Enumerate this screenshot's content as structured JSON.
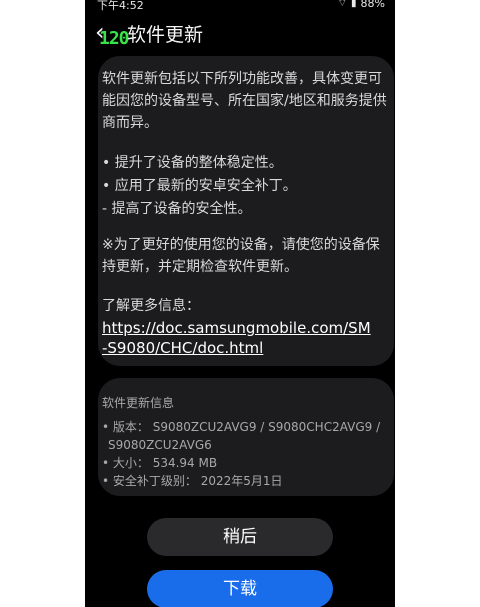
{
  "statusbar": {
    "time": "下午4:52",
    "battery": "88%"
  },
  "header": {
    "fps": "120",
    "title": "软件更新"
  },
  "intro": "软件更新包括以下所列功能改善，具体变更可能因您的设备型号、所在国家/地区和服务提供商而异。",
  "bullets": [
    "• 提升了设备的整体稳定性。",
    "• 应用了最新的安卓安全补丁。",
    " - 提高了设备的安全性。"
  ],
  "advice": "※为了更好的使用您的设备，请使您的设备保持更新，并定期检查软件更新。",
  "learn_more_label": "了解更多信息：",
  "link_url": "https://doc.samsungmobile.com/SM-S9080/CHC/doc.html",
  "link_line1": "https://doc.samsungmobile.com/SM",
  "link_line2": "-S9080/CHC/doc.html",
  "info": {
    "title": "软件更新信息",
    "lines": [
      "• 版本： S9080ZCU2AVG9 / S9080CHC2AVG9 /",
      "  S9080ZCU2AVG6",
      "• 大小： 534.94 MB",
      "• 安全补丁级别： 2022年5月1日"
    ]
  },
  "buttons": {
    "later": "稍后",
    "download": "下载"
  }
}
